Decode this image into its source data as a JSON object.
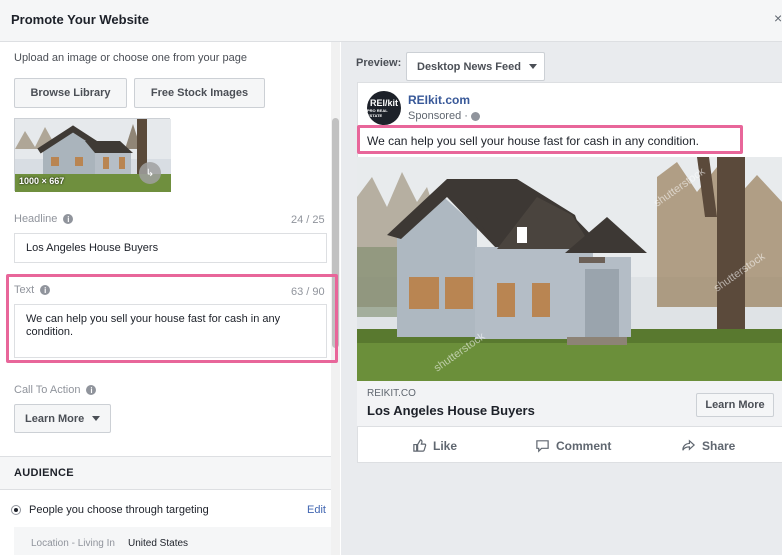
{
  "header": {
    "title": "Promote Your Website",
    "close": "×"
  },
  "creative": {
    "upload_hint": "Upload an image or choose one from your page",
    "browse_label": "Browse Library",
    "stock_label": "Free Stock Images",
    "thumb_size": "1000 × 667"
  },
  "headline": {
    "label": "Headline",
    "counter": "24 / 25",
    "value": "Los Angeles House Buyers"
  },
  "text_field": {
    "label": "Text",
    "counter": "63 / 90",
    "value": "We can help you sell your house fast for cash in any condition."
  },
  "cta": {
    "label": "Call To Action",
    "value": "Learn More"
  },
  "audience": {
    "section_title": "AUDIENCE",
    "option": "People you choose through targeting",
    "edit": "Edit",
    "location_key": "Location - Living In",
    "location_value": "United States"
  },
  "preview": {
    "label": "Preview:",
    "placement": "Desktop News Feed",
    "logo_line1": "REI/kit",
    "logo_line2": "PRO REAL ESTATE",
    "page_name": "REIkit.com",
    "sponsored": "Sponsored ·",
    "post_text": "We can help you sell your house fast for cash in any condition.",
    "watermark": "shutterstock",
    "link_domain": "REIKIT.CO",
    "link_title": "Los Angeles House Buyers",
    "cta_button": "Learn More",
    "actions": {
      "like": "Like",
      "comment": "Comment",
      "share": "Share"
    }
  },
  "colors": {
    "highlight": "#e8669a",
    "link": "#385898",
    "panel_bg": "#e9ebee"
  }
}
